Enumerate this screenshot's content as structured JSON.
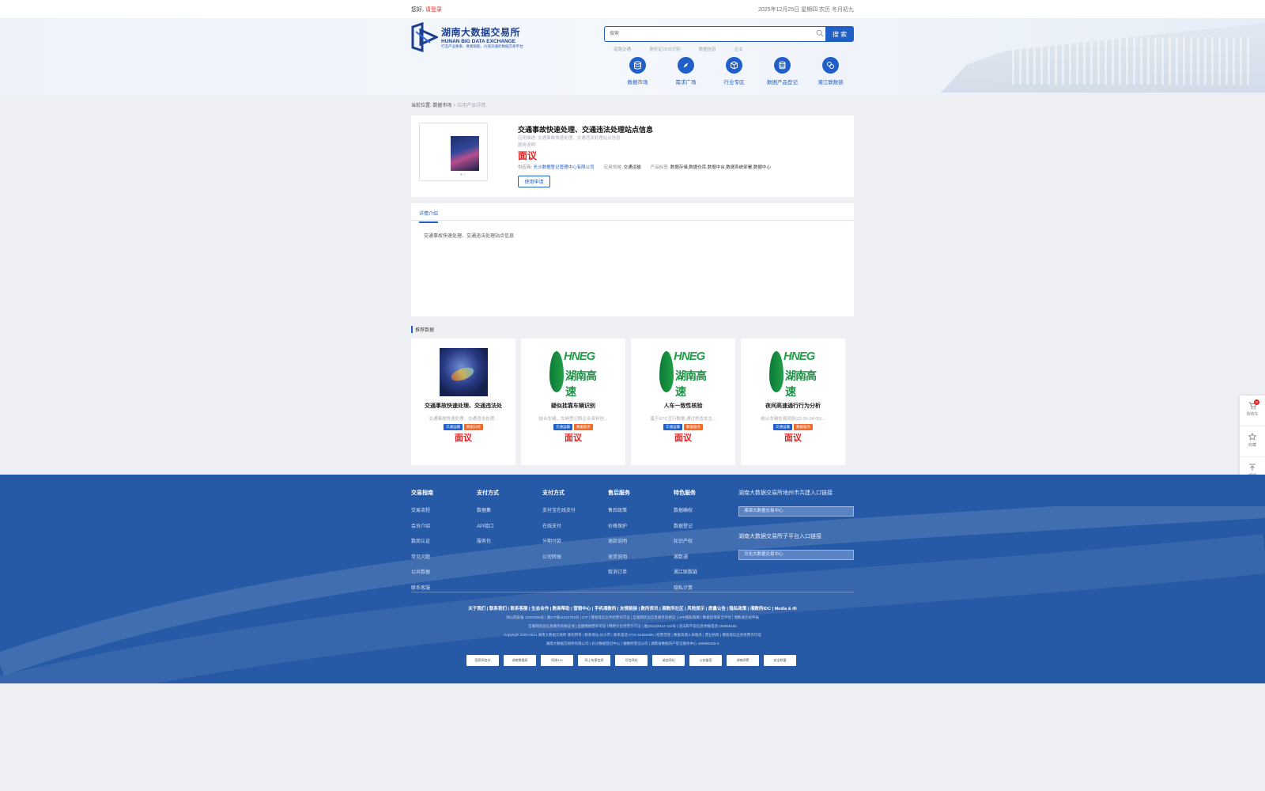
{
  "topbar": {
    "greeting": "您好,",
    "login_label": "请登录",
    "date": "2025年12月25日 星期四",
    "lunar": "农历 冬月初九"
  },
  "header": {
    "logo_cn": "湖南大数据交易所",
    "logo_en": "HUNAN BIG DATA EXCHANGE",
    "logo_slogan": "打造产业要素、要素赋能、价值流通的数据交易平台",
    "search_placeholder": "搜索",
    "search_button": "搜 索",
    "hotwords": [
      "道路交通",
      "身份证OCR识别",
      "数据信息",
      "企业"
    ],
    "nav": [
      "数据市场",
      "需求广场",
      "行业专区",
      "数据产品登记",
      "湘江联数链"
    ]
  },
  "breadcrumb": {
    "label": "当前位置:",
    "level1": "数据市场",
    "sep": ">",
    "current": "应用产品详情"
  },
  "product": {
    "title": "交通事故快速处理、交通违法处理站点信息",
    "desc_label": "应用描述:",
    "desc": "交通事故快速处理、交通违法处理站点信息",
    "service_label": "服务说明:",
    "price": "面议",
    "supplier_label": "供应商:",
    "supplier": "长沙数据登记管理中心有限公司",
    "field_label": "应用领域:",
    "field": "交通运输",
    "tags_label": "产品标签:",
    "tags": "数据存储,数据仓库,数据中台,数据系统部署,数据中心",
    "apply_button": "使用申请",
    "thumb_dots": "● ○"
  },
  "detail": {
    "tab": "详情介绍",
    "body": "交通事故快速处理、交通违法处理站点信息"
  },
  "recommend": {
    "title": "推荐数据",
    "items": [
      {
        "name": "交通事故快速处理、交通违法处",
        "desc": "交通事故快速处理、交通违法处理...",
        "tag1": "交通运输",
        "tag2": "数据分析",
        "price": "面议"
      },
      {
        "name": "疑似挂靠车辆识别",
        "desc": "结合车辆、车辆登记和企业资料信...",
        "tag1": "交通运输",
        "tag2": "数据服务",
        "price": "面议"
      },
      {
        "name": "人车一致性核验",
        "desc": "基于ETC互行数据,通过核查车主...",
        "tag1": "交通运输",
        "tag2": "数据服务",
        "price": "面议"
      },
      {
        "name": "夜间高速通行行为分析",
        "desc": "统计车辆在夜间段(22:00-24:00)...",
        "tag1": "交通运输",
        "tag2": "数据服务",
        "price": "面议"
      }
    ],
    "hneg_en": "HNEG",
    "hneg_cn": "湖南高速"
  },
  "side": {
    "cart": "购物车",
    "fav": "收藏",
    "top": "顶部",
    "badge": "0"
  },
  "footer": {
    "cols": [
      {
        "title": "交易指南",
        "items": [
          "交易流程",
          "会员介绍",
          "数商认证",
          "常见问题",
          "公共数据",
          "联系客服"
        ]
      },
      {
        "title": "支付方式",
        "items": [
          "数据集",
          "API接口",
          "服务包"
        ]
      },
      {
        "title": "支付方式",
        "items": [
          "支付宝在线支付",
          "在线支付",
          "分期付款",
          "公司转账"
        ]
      },
      {
        "title": "售后服务",
        "items": [
          "售后政策",
          "价格保护",
          "退款说明",
          "退货说明",
          "取消订单"
        ]
      },
      {
        "title": "特色服务",
        "items": [
          "数据确权",
          "数据登记",
          "知识产权",
          "湘数通",
          "湘江联数链",
          "隐私计算"
        ]
      }
    ],
    "right_title1": "湖南大数据交易所地州市共建入口链接",
    "right_select1": "湘潭大数据交易中心",
    "right_title2": "湖南大数据交易所子平台入口链接",
    "right_select2": "文化大数据交易中心",
    "links": "关于我们 | 联系我们 | 联系客服 | 生态合作 | 数商帮助 | 营销中心 | 手机湘数所 | 友情链接 | 数所资讯 | 湘数所社区 | 风险提示 | 质量公告 | 隐私政策 | 湘数所IDC | Media & IR",
    "line1": "湖公网安备 11002000号 | 湘ICP备11041784号 | ICP | 增值电信业务经营许可证 | 互联网药品信息服务资格证 | APP隐私政策 | 数据出境安全评估 | 湘数通合规申报",
    "line2": "互联网药品信息服务资格证书 | 出版物经营许可证 | 网络文化经营许可证 | 湘(2023)0112-123号 | 违法和不良信息举报电话:400656155",
    "line3": "Copyright 2000-2024 湖南大数据交易所 版权所有 | 联系地址:长沙市 | 联系电话:0731-81555366 | 经营范围 | 数据资源入表服务 | 营业执照 | 增值电信业务经营许可证",
    "line4": "湖南大数据交易所有限公司 | 长沙数据登记中心 | 湘数所登记公司 | 湖南省数据资产登记服务中心 400656155-3",
    "badges": [
      "国家网信办",
      "湖南数据局",
      "网络110",
      "网上有害信息",
      "可信网站",
      "诚信网站",
      "公安备案",
      "湖南网警",
      "安全联盟"
    ]
  }
}
